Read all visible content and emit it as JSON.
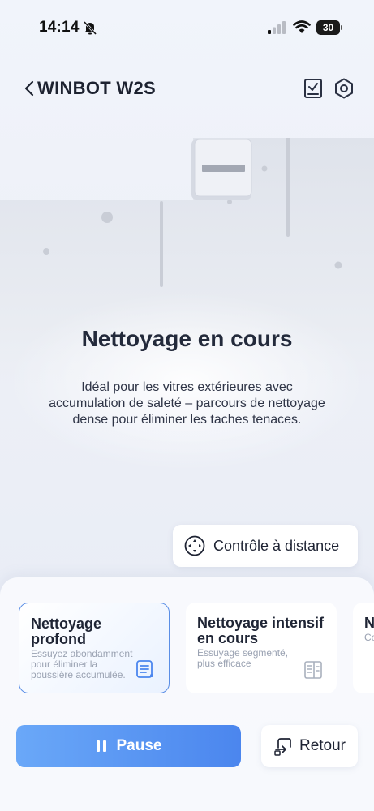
{
  "status_bar": {
    "time": "14:14",
    "battery": "30"
  },
  "header": {
    "title": "WINBOT W2S"
  },
  "main": {
    "title": "Nettoyage en cours",
    "description": "Idéal pour les vitres extérieures avec accumulation de saleté – parcours de nettoyage dense pour éliminer les taches tenaces."
  },
  "remote_control": {
    "label": "Contrôle à distance"
  },
  "modes": [
    {
      "title": "Nettoyage profond",
      "description": "Essuyez abondamment pour éliminer la poussière accumulée.",
      "selected": true
    },
    {
      "title": "Nettoyage intensif en cours",
      "description": "Essuyage segmenté, plus efficace",
      "selected": false
    },
    {
      "title": "Nettoyage intensif",
      "description": "Co et",
      "selected": false
    }
  ],
  "actions": {
    "pause_label": "Pause",
    "return_label": "Retour"
  },
  "colors": {
    "accent": "#4b86ee",
    "accent_light": "#6aa8f8",
    "selected_border": "#5a8ee6"
  }
}
